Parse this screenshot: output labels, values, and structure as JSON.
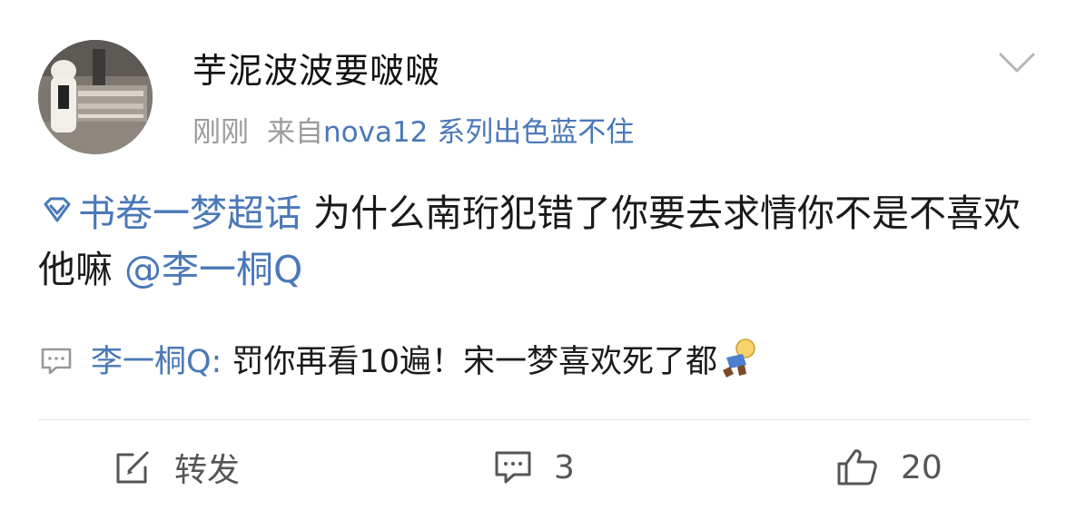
{
  "user": {
    "name": "芋泥波波要啵啵",
    "time": "刚刚",
    "source_prefix": "来自",
    "device": "nova12 系列出色蓝不住",
    "avatar": "avatar-photo"
  },
  "post": {
    "topic": "书卷一梦超话",
    "text": " 为什么南珩犯错了你要去求情你不是不喜欢他嘛 ",
    "mention": "@李一桐Q"
  },
  "comment_preview": {
    "user": "李一桐Q: ",
    "text": "罚你再看10遍！宋一梦喜欢死了都",
    "emoji": "doll-emoji"
  },
  "actions": {
    "repost_label": "转发",
    "comment_count": "3",
    "like_count": "20"
  },
  "icons": {
    "more": "chevron-down-icon",
    "topic": "diamond-icon",
    "comment_preview": "comment-bubble-icon",
    "repost": "repost-icon",
    "comment": "comment-icon",
    "like": "thumbs-up-icon"
  },
  "colors": {
    "link": "#4a78b8",
    "meta": "#9b9b9b",
    "text": "#1a1a1a"
  }
}
